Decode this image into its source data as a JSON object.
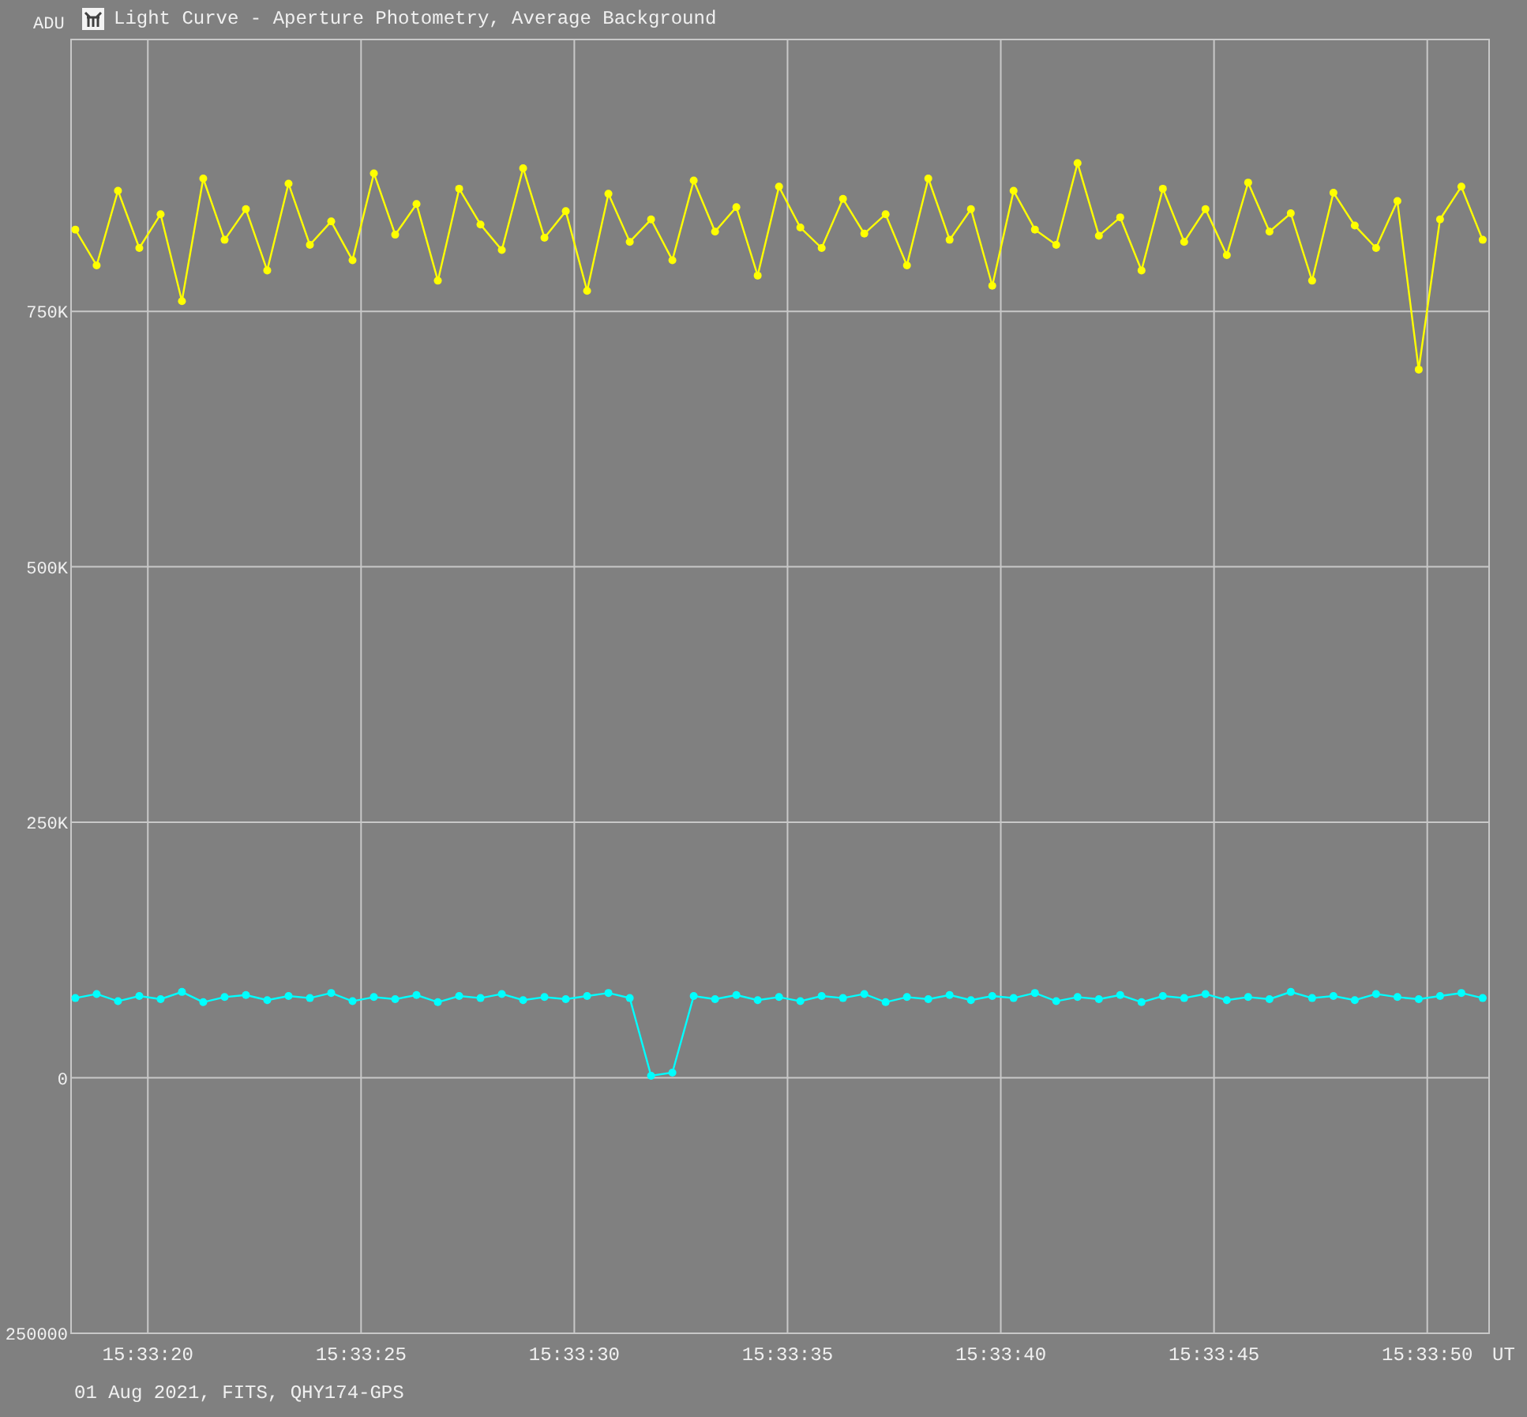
{
  "window": {
    "title": "Light Curve - Aperture Photometry, Average Background"
  },
  "chart_data": {
    "type": "line",
    "grid": true,
    "xlabel": "UT",
    "ylabel": "ADU",
    "xlim": [
      55998.2,
      56031.45
    ],
    "ylim": [
      -250000,
      1016000
    ],
    "xticks": [
      {
        "value": 56000,
        "label": "15:33:20"
      },
      {
        "value": 56005,
        "label": "15:33:25"
      },
      {
        "value": 56010,
        "label": "15:33:30"
      },
      {
        "value": 56015,
        "label": "15:33:35"
      },
      {
        "value": 56020,
        "label": "15:33:40"
      },
      {
        "value": 56025,
        "label": "15:33:45"
      },
      {
        "value": 56030,
        "label": "15:33:50"
      }
    ],
    "yticks": [
      {
        "value": -250000,
        "label": "250000"
      },
      {
        "value": 0,
        "label": "0"
      },
      {
        "value": 250000,
        "label": "250K"
      },
      {
        "value": 500000,
        "label": "500K"
      },
      {
        "value": 750000,
        "label": "750K"
      }
    ],
    "x": [
      55998.3,
      55998.8,
      55999.3,
      55999.8,
      56000.3,
      56000.8,
      56001.3,
      56001.8,
      56002.3,
      56002.8,
      56003.3,
      56003.8,
      56004.3,
      56004.8,
      56005.3,
      56005.8,
      56006.3,
      56006.8,
      56007.3,
      56007.8,
      56008.3,
      56008.8,
      56009.3,
      56009.8,
      56010.3,
      56010.8,
      56011.3,
      56011.8,
      56012.3,
      56012.8,
      56013.3,
      56013.8,
      56014.3,
      56014.8,
      56015.3,
      56015.8,
      56016.3,
      56016.8,
      56017.3,
      56017.8,
      56018.3,
      56018.8,
      56019.3,
      56019.8,
      56020.3,
      56020.8,
      56021.3,
      56021.8,
      56022.3,
      56022.8,
      56023.3,
      56023.8,
      56024.3,
      56024.8,
      56025.3,
      56025.8,
      56026.3,
      56026.8,
      56027.3,
      56027.8,
      56028.3,
      56028.8,
      56029.3,
      56029.8,
      56030.3,
      56030.8,
      56031.3
    ],
    "series": [
      {
        "color": "#ffff00",
        "marker": "circle",
        "values": [
          830000,
          795000,
          868000,
          812000,
          845000,
          760000,
          880000,
          820000,
          850000,
          790000,
          875000,
          815000,
          838000,
          800000,
          885000,
          825000,
          855000,
          780000,
          870000,
          835000,
          810000,
          890000,
          822000,
          848000,
          770000,
          865000,
          818000,
          840000,
          800000,
          878000,
          828000,
          852000,
          785000,
          872000,
          832000,
          812000,
          860000,
          826000,
          845000,
          795000,
          880000,
          820000,
          850000,
          775000,
          868000,
          830000,
          815000,
          895000,
          824000,
          842000,
          790000,
          870000,
          818000,
          850000,
          805000,
          876000,
          828000,
          846000,
          780000,
          866000,
          834000,
          812000,
          858000,
          693000,
          840000,
          872000,
          820000
        ]
      },
      {
        "color": "#00ffff",
        "marker": "circle",
        "values": [
          78000,
          82000,
          75000,
          80000,
          77000,
          84000,
          74000,
          79000,
          81000,
          76000,
          80000,
          78000,
          83000,
          75000,
          79000,
          77000,
          81000,
          74000,
          80000,
          78000,
          82000,
          76000,
          79000,
          77000,
          80000,
          83000,
          78000,
          2000,
          5000,
          80000,
          77000,
          81000,
          76000,
          79000,
          75000,
          80000,
          78000,
          82000,
          74000,
          79000,
          77000,
          81000,
          76000,
          80000,
          78000,
          83000,
          75000,
          79000,
          77000,
          81000,
          74000,
          80000,
          78000,
          82000,
          76000,
          79000,
          77000,
          84000,
          78000,
          80000,
          76000,
          82000,
          79000,
          77000,
          80000,
          83000,
          78000
        ]
      }
    ]
  },
  "status_bar": {
    "text": "01 Aug 2021, FITS, QHY174-GPS"
  }
}
